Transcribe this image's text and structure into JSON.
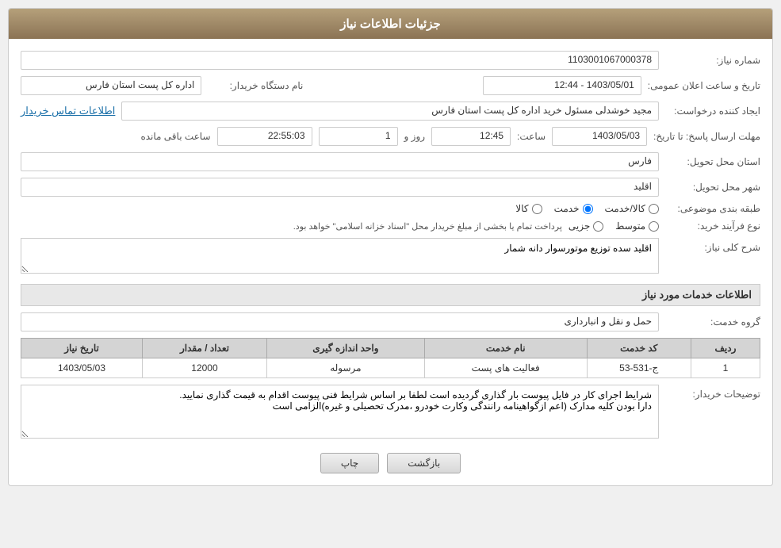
{
  "header": {
    "title": "جزئیات اطلاعات نیاز"
  },
  "fields": {
    "need_number_label": "شماره نیاز:",
    "need_number_value": "1103001067000378",
    "buyer_org_label": "نام دستگاه خریدار:",
    "buyer_org_value": "اداره کل پست استان فارس",
    "announce_date_label": "تاریخ و ساعت اعلان عمومی:",
    "announce_date_value": "1403/05/01 - 12:44",
    "creator_label": "ایجاد کننده درخواست:",
    "creator_value": "مجید خوشدلی مسئول خرید اداره کل پست استان فارس",
    "contact_info_link": "اطلاعات تماس خریدار",
    "deadline_label": "مهلت ارسال پاسخ: تا تاریخ:",
    "deadline_date": "1403/05/03",
    "deadline_time_label": "ساعت:",
    "deadline_time": "12:45",
    "deadline_days_label": "روز و",
    "deadline_days": "1",
    "deadline_remaining_label": "ساعت باقی مانده",
    "deadline_remaining": "22:55:03",
    "province_label": "استان محل تحویل:",
    "province_value": "فارس",
    "city_label": "شهر محل تحویل:",
    "city_value": "اقلید",
    "category_label": "طبقه بندی موضوعی:",
    "category_options": [
      "کالا",
      "خدمت",
      "کالا/خدمت"
    ],
    "category_selected": "خدمت",
    "purchase_type_label": "نوع فرآیند خرید:",
    "purchase_type_options": [
      "جزیی",
      "متوسط"
    ],
    "purchase_type_note": "پرداخت تمام یا بخشی از مبلغ خریدار محل \"اسناد خزانه اسلامی\" خواهد بود.",
    "summary_label": "شرح کلی نیاز:",
    "summary_value": "اقلید سده توزیع موتورسوار دانه شمار",
    "services_title": "اطلاعات خدمات مورد نیاز",
    "service_group_label": "گروه خدمت:",
    "service_group_value": "حمل و نقل و انبارداری",
    "table": {
      "headers": [
        "ردیف",
        "کد خدمت",
        "نام خدمت",
        "واحد اندازه گیری",
        "تعداد / مقدار",
        "تاریخ نیاز"
      ],
      "rows": [
        {
          "row": "1",
          "code": "ج-531-53",
          "name": "فعالیت های پست",
          "unit": "مرسوله",
          "quantity": "12000",
          "date": "1403/05/03"
        }
      ]
    },
    "buyer_description_label": "توضیحات خریدار:",
    "buyer_description_value": "شرایط اجرای کار در فایل پیوست بار گذاری گردیده است لطفا بر اساس شرایط فنی پیوست اقدام به قیمت گذاری نمایید.\nدارا بودن کلیه مدارک (اعم ازگواهینامه رانندگی وکارت خودرو ،مدرک تحصیلی و غیره)الزامی است"
  },
  "buttons": {
    "print_label": "چاپ",
    "back_label": "بازگشت"
  }
}
